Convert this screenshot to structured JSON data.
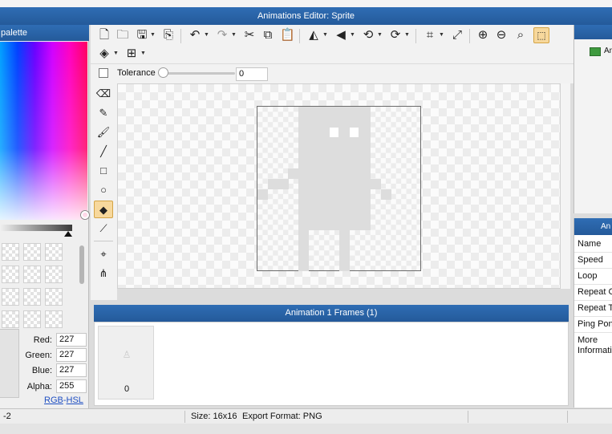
{
  "window": {
    "title": "Animations Editor: Sprite"
  },
  "palette": {
    "header": "palette",
    "channels": [
      {
        "label": "Red:",
        "value": "227"
      },
      {
        "label": "Green:",
        "value": "227"
      },
      {
        "label": "Blue:",
        "value": "227"
      },
      {
        "label": "Alpha:",
        "value": "255"
      }
    ],
    "modes": {
      "rgb": "RGB",
      "sep": "-",
      "hsl": "HSL"
    }
  },
  "toolbar": {
    "icons": [
      "new-file-icon",
      "open-folder-icon",
      "save-icon",
      "export-icon",
      "undo-icon",
      "redo-icon",
      "cut-icon",
      "copy-icon",
      "paste-icon",
      "flip-horizontal-icon",
      "flip-vertical-icon",
      "rotate-left-icon",
      "rotate-right-icon",
      "crop-icon",
      "resize-icon",
      "zoom-in-icon",
      "zoom-out-icon",
      "zoom-reset-icon",
      "select-tool-icon"
    ],
    "tolerance_label": "Tolerance",
    "tolerance_value": "0",
    "tolerance_fraction": 0.0
  },
  "tools": [
    "eraser-icon",
    "pencil-icon",
    "brush-icon",
    "line-icon",
    "rectangle-icon",
    "ellipse-icon",
    "fill-bucket-icon",
    "eyedropper-icon",
    "move-point-icon",
    "nodes-icon"
  ],
  "colors": {
    "accent": "#2a64a8",
    "active_tool": "#f7d89c",
    "sprite_fill": "#dddddd"
  },
  "frames": {
    "header": "Animation 1 Frames (1)",
    "items": [
      {
        "index": "0"
      }
    ]
  },
  "animations": {
    "item_label": "An"
  },
  "properties": {
    "header": "An",
    "rows": [
      "Name",
      "Speed",
      "Loop",
      "Repeat C",
      "Repeat Ti",
      "Ping Pong",
      "More Informati"
    ]
  },
  "status": {
    "left": "-2",
    "size": "Size: 16x16",
    "format": "Export Format: PNG"
  }
}
